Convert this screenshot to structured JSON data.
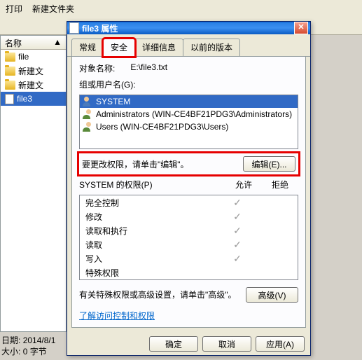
{
  "bg": {
    "toolbar": {
      "print": "打印",
      "new_file": "新建文件夹"
    },
    "header_name": "名称",
    "header_arrow": "▲",
    "items": [
      {
        "icon": "folder",
        "label": "file"
      },
      {
        "icon": "folder",
        "label": "新建文"
      },
      {
        "icon": "folder",
        "label": "新建文"
      },
      {
        "icon": "file",
        "label": "file3",
        "selected": true
      }
    ],
    "status_date_label": "日期:",
    "status_date": "2014/8/1",
    "status_size_label": "大小:",
    "status_size": "0 字节"
  },
  "dialog": {
    "title": "file3 属性",
    "tabs": [
      {
        "label": "常规",
        "active": false
      },
      {
        "label": "安全",
        "active": true,
        "highlight": true
      },
      {
        "label": "详细信息",
        "active": false
      },
      {
        "label": "以前的版本",
        "active": false
      }
    ],
    "object_label": "对象名称:",
    "object_value": "E:\\file3.txt",
    "groups_label": "组或用户名(G):",
    "principals": [
      {
        "name": "SYSTEM",
        "selected": true,
        "type": "user"
      },
      {
        "name": "Administrators (WIN-CE4BF21PDG3\\Administrators)",
        "type": "group"
      },
      {
        "name": "Users (WIN-CE4BF21PDG3\\Users)",
        "type": "group"
      }
    ],
    "edit_text": "要更改权限，请单击\"编辑\"。",
    "edit_btn": "编辑(E)...",
    "perm_label": "SYSTEM 的权限(P)",
    "allow": "允许",
    "deny": "拒绝",
    "permissions": [
      {
        "name": "完全控制",
        "allow": true
      },
      {
        "name": "修改",
        "allow": true
      },
      {
        "name": "读取和执行",
        "allow": true
      },
      {
        "name": "读取",
        "allow": true
      },
      {
        "name": "写入",
        "allow": true
      },
      {
        "name": "特殊权限",
        "allow": false
      }
    ],
    "advanced_text": "有关特殊权限或高级设置，请单击\"高级\"。",
    "advanced_btn": "高级(V)",
    "learn_link": "了解访问控制和权限",
    "ok": "确定",
    "cancel": "取消",
    "apply": "应用(A)"
  }
}
